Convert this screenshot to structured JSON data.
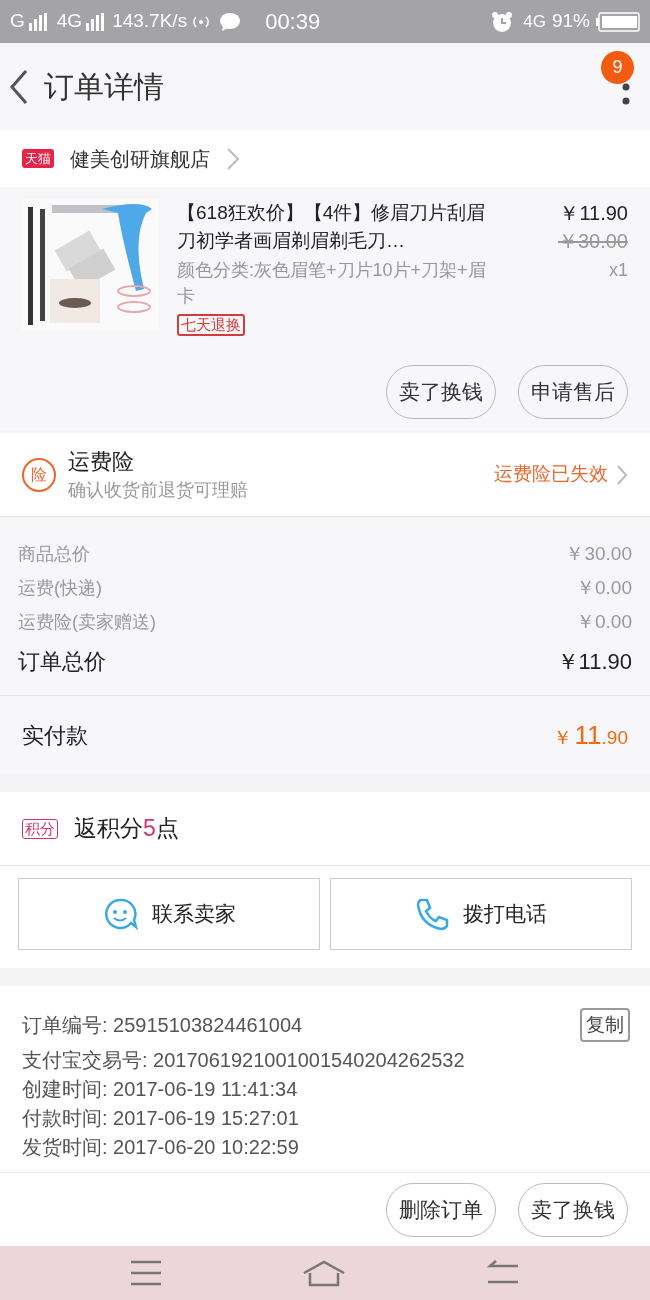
{
  "status_bar": {
    "left": [
      "G",
      "4G",
      "143.7K/s"
    ],
    "time": "00:39",
    "network": "4G",
    "battery": "91%"
  },
  "header": {
    "title": "订单详情",
    "badge": "9"
  },
  "shop": {
    "tag": "天猫",
    "name": "健美创研旗舰店"
  },
  "product": {
    "title": "【618狂欢价】【4件】修眉刀片刮眉刀初学者画眉剃眉剃毛刀…",
    "variant": "颜色分类:灰色眉笔+刀片10片+刀架+眉卡",
    "tag": "七天退换",
    "price": "￥11.90",
    "original_price": "￥30.00",
    "quantity": "x1",
    "buttons": [
      "卖了换钱",
      "申请售后"
    ]
  },
  "insurance": {
    "icon": "险",
    "title": "运费险",
    "subtitle": "确认收货前退货可理赔",
    "status": "运费险已失效"
  },
  "summary": [
    {
      "label": "商品总价",
      "value": "￥30.00",
      "kind": "minor"
    },
    {
      "label": "运费(快递)",
      "value": "￥0.00",
      "kind": "minor"
    },
    {
      "label": "运费险(卖家赠送)",
      "value": "￥0.00",
      "kind": "minor"
    },
    {
      "label": "订单总价",
      "value": "￥11.90",
      "kind": "major"
    }
  ],
  "payment": {
    "label": "实付款",
    "currency": "￥",
    "amount": "11",
    "decimals": ".90"
  },
  "points": {
    "tag": "积分",
    "text": "返积分",
    "count": "5",
    "unit": "点"
  },
  "contact_buttons": [
    {
      "label": "联系卖家",
      "kind": "chat"
    },
    {
      "label": "拨打电话",
      "kind": "phone"
    }
  ],
  "details": {
    "copy_button": "复制",
    "rows": [
      {
        "label": "订单编号:",
        "value": "25915103824461004"
      },
      {
        "label": "支付宝交易号:",
        "value": "2017061921001001540204262532"
      },
      {
        "label": "创建时间:",
        "value": "2017-06-19 11:41:34"
      },
      {
        "label": "付款时间:",
        "value": "2017-06-19 15:27:01"
      },
      {
        "label": "发货时间:",
        "value": "2017-06-20 10:22:59"
      }
    ]
  },
  "bottom_buttons": [
    "删除订单",
    "卖了换钱"
  ]
}
